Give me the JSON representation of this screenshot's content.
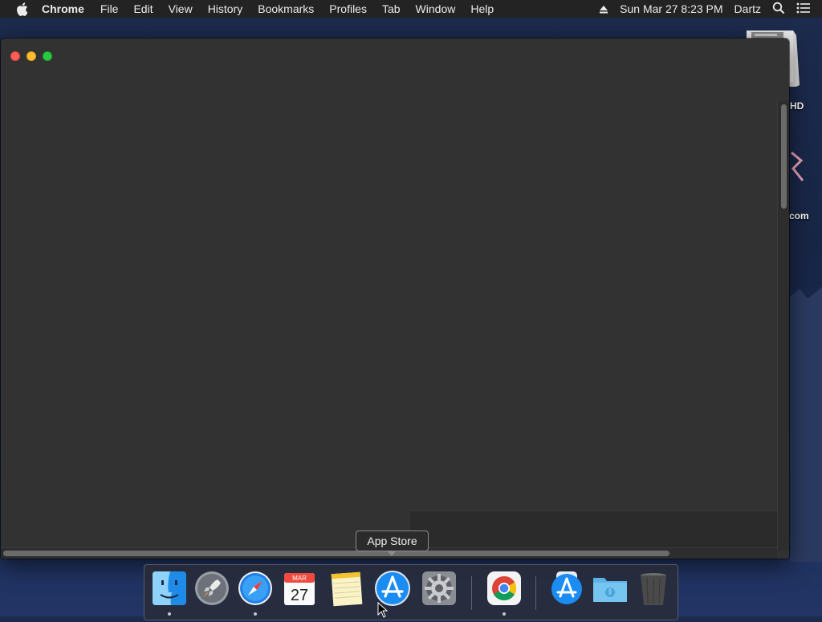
{
  "menubar": {
    "app_name": "Chrome",
    "items": [
      "File",
      "Edit",
      "View",
      "History",
      "Bookmarks",
      "Profiles",
      "Tab",
      "Window",
      "Help"
    ],
    "clock": "Sun Mar 27  8:23 PM",
    "user": "Dartz",
    "icons": [
      "apple-icon",
      "eject-icon",
      "spotlight-search-icon",
      "notification-center-icon"
    ]
  },
  "desktop": {
    "labels": [
      "HD",
      "com"
    ]
  },
  "tooltip": {
    "text": "App Store"
  },
  "dock": {
    "items": [
      {
        "name": "Finder",
        "icon": "finder-icon",
        "running": true
      },
      {
        "name": "Launchpad",
        "icon": "launchpad-icon",
        "running": false
      },
      {
        "name": "Safari",
        "icon": "safari-icon",
        "running": true
      },
      {
        "name": "Calendar",
        "icon": "calendar-icon",
        "running": false
      },
      {
        "name": "Notes",
        "icon": "notes-icon",
        "running": false
      },
      {
        "name": "App Store",
        "icon": "app-store-icon",
        "running": false
      },
      {
        "name": "System Preferences",
        "icon": "system-preferences-icon",
        "running": false
      },
      {
        "name": "Google Chrome",
        "icon": "chrome-icon",
        "running": true
      },
      {
        "name": "Applications",
        "icon": "app-store-folder-icon",
        "running": false
      },
      {
        "name": "Downloads",
        "icon": "downloads-folder-icon",
        "running": false
      },
      {
        "name": "Trash",
        "icon": "trash-icon",
        "running": false
      }
    ],
    "calendar": {
      "month": "MAR",
      "day": "27"
    }
  },
  "colors": {
    "window_bg": "#323232",
    "menubar_bg": "#232323",
    "close": "#fd5f57",
    "minimize": "#febc2e",
    "zoom": "#28c840"
  }
}
